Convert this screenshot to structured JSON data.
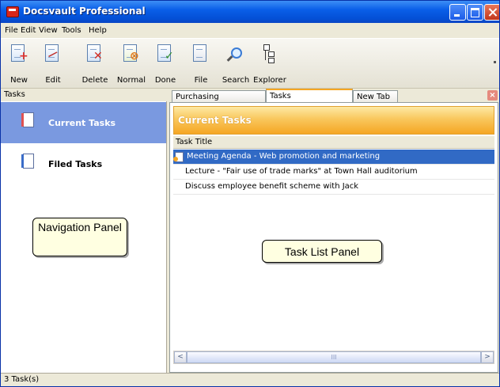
{
  "window": {
    "title": "Docsvault Professional"
  },
  "menu": {
    "items": [
      "File",
      "Edit",
      "View",
      "Tools",
      "Help"
    ]
  },
  "toolbar": {
    "buttons": [
      {
        "label": "New",
        "icon": "new-task-icon"
      },
      {
        "label": "Edit",
        "icon": "edit-icon"
      },
      {
        "label": "Delete",
        "icon": "delete-icon"
      },
      {
        "label": "Normal",
        "icon": "normal-priority-icon"
      },
      {
        "label": "Done",
        "icon": "done-icon"
      },
      {
        "label": "File",
        "icon": "file-icon"
      },
      {
        "label": "Search",
        "icon": "search-icon"
      },
      {
        "label": "Explorer",
        "icon": "explorer-icon"
      }
    ]
  },
  "nav": {
    "header": "Tasks",
    "items": [
      {
        "label": "Current Tasks",
        "selected": true,
        "icon": "current-tasks-icon"
      },
      {
        "label": "Filed Tasks",
        "selected": false,
        "icon": "filed-tasks-icon"
      }
    ]
  },
  "tabs": {
    "items": [
      {
        "label": "Purchasing",
        "active": false
      },
      {
        "label": "Tasks",
        "active": true
      },
      {
        "label": "New Tab",
        "active": false
      }
    ],
    "close_glyph": "×"
  },
  "tasks": {
    "header": "Current Tasks",
    "column": "Task Title",
    "rows": [
      {
        "title": "Meeting Agenda - Web promotion and marketing",
        "selected": true
      },
      {
        "title": "Lecture - \"Fair use of trade marks\" at Town Hall auditorium",
        "selected": false
      },
      {
        "title": "Discuss employee benefit scheme with Jack",
        "selected": false
      }
    ]
  },
  "scrollbar": {
    "left": "<",
    "right": ">",
    "thumb": "III"
  },
  "callouts": {
    "navigation": "Navigation Panel",
    "tasklist": "Task List Panel"
  },
  "status": {
    "text": "3 Task(s)"
  },
  "colors": {
    "title_bar": "#0a5fe8",
    "nav_selected": "#7a99e0",
    "task_header": "#f5a623",
    "row_selected": "#316ac5"
  }
}
